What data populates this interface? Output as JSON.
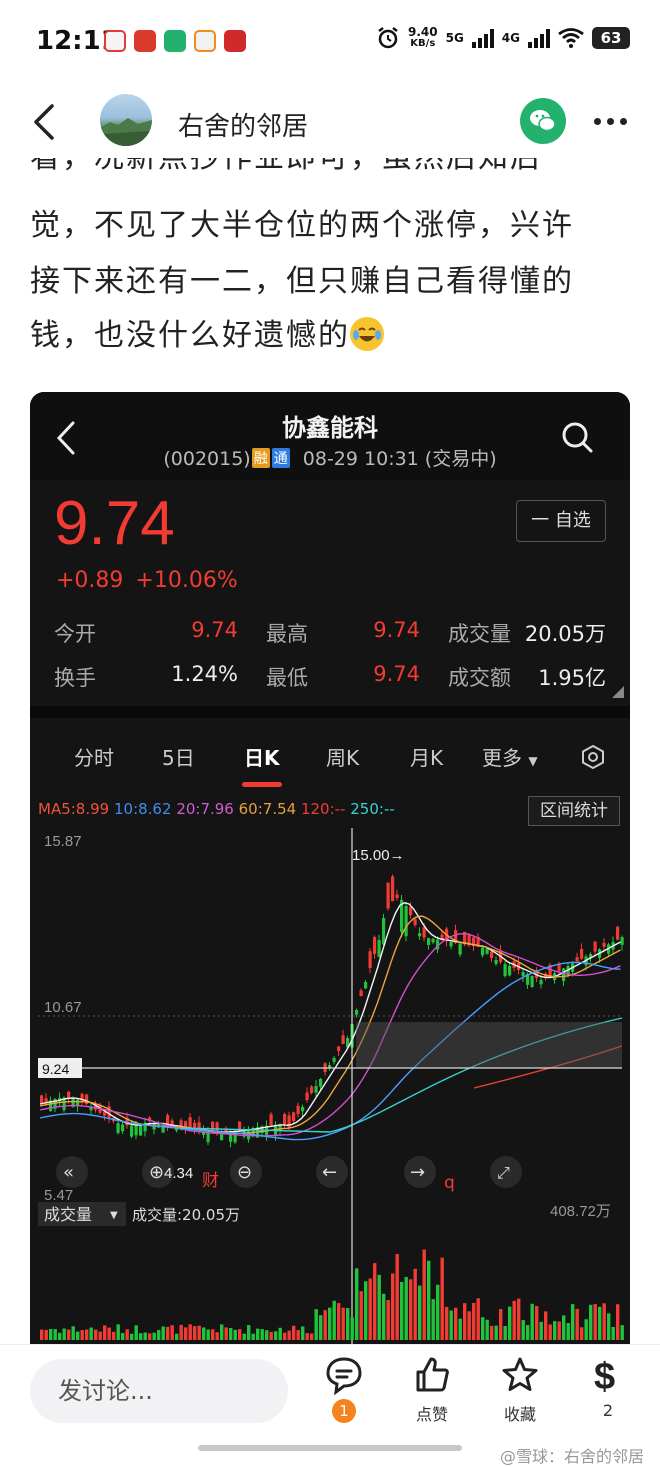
{
  "status_bar": {
    "time": "12:11",
    "net_speed_value": "9.40",
    "net_speed_unit": "KB/s",
    "sig1": "5G",
    "sig2": "4G",
    "battery": "63"
  },
  "header": {
    "username": "右舍的邻居"
  },
  "article": {
    "cut_line": "看，况新点抄作业即可，虽然后知后",
    "lines": [
      "觉，不见了大半仓位的两个涨停，兴许",
      "接下来还有一二，但只赚自己看得懂的",
      "钱，也没什么好遗憾的"
    ]
  },
  "stock": {
    "name": "协鑫能科",
    "code": "(002015)",
    "tag1": "融",
    "tag2": "通",
    "datetime": "08-29 10:31 (交易中)",
    "price": "9.74",
    "change": "+0.89",
    "change_pct": "+10.06%",
    "watch_label": "一 自选",
    "quotes": {
      "open_label": "今开",
      "open": "9.74",
      "high_label": "最高",
      "high": "9.74",
      "volume_label": "成交量",
      "volume": "20.05万",
      "turnover_label": "换手",
      "turnover": "1.24%",
      "low_label": "最低",
      "low": "9.74",
      "amount_label": "成交额",
      "amount": "1.95亿"
    },
    "tabs": [
      "分时",
      "5日",
      "日K",
      "周K",
      "月K",
      "更多"
    ],
    "active_tab": "日K",
    "ma": {
      "ma5": "MA5:8.99",
      "ma10": "10:8.62",
      "ma20": "20:7.96",
      "ma60": "60:7.54",
      "ma120": "120:--",
      "ma250": "250:--"
    },
    "range_button": "区间统计",
    "chart_labels": {
      "y_top": "15.87",
      "y_mid": "10.67",
      "crosshair": "9.24",
      "y_low": "5.47",
      "peak": "15.00→",
      "low_mark": "4.34",
      "cai": "财",
      "q": "q",
      "volume_selector": "成交量",
      "volume_value": "成交量:20.05万",
      "volume_max": "408.72万"
    },
    "colors": {
      "up": "#f23b32",
      "down": "#1fc33c",
      "ma5": "#f4f4f4",
      "ma10": "#f0a53a",
      "ma20": "#d14fd1",
      "ma60": "#4aa0ff",
      "ma120": "#3ad1d1",
      "ma250": "#e8463a"
    }
  },
  "bottom_bar": {
    "comment_placeholder": "发讨论...",
    "comment_count": "1",
    "like_label": "点赞",
    "fav_label": "收藏",
    "reward_count": "2",
    "watermark": "@雪球：右舍的邻居"
  }
}
